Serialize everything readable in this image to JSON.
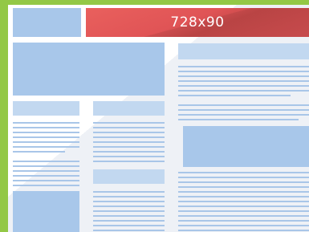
{
  "ad_banner": {
    "label": "728x90"
  },
  "colors": {
    "page_background": "#93c846",
    "frame_background": "#ffffff",
    "placeholder_block": "#a8c7ea",
    "placeholder_line": "#a9c6e8",
    "banner": "#e05456",
    "banner_text": "#ffffff"
  }
}
